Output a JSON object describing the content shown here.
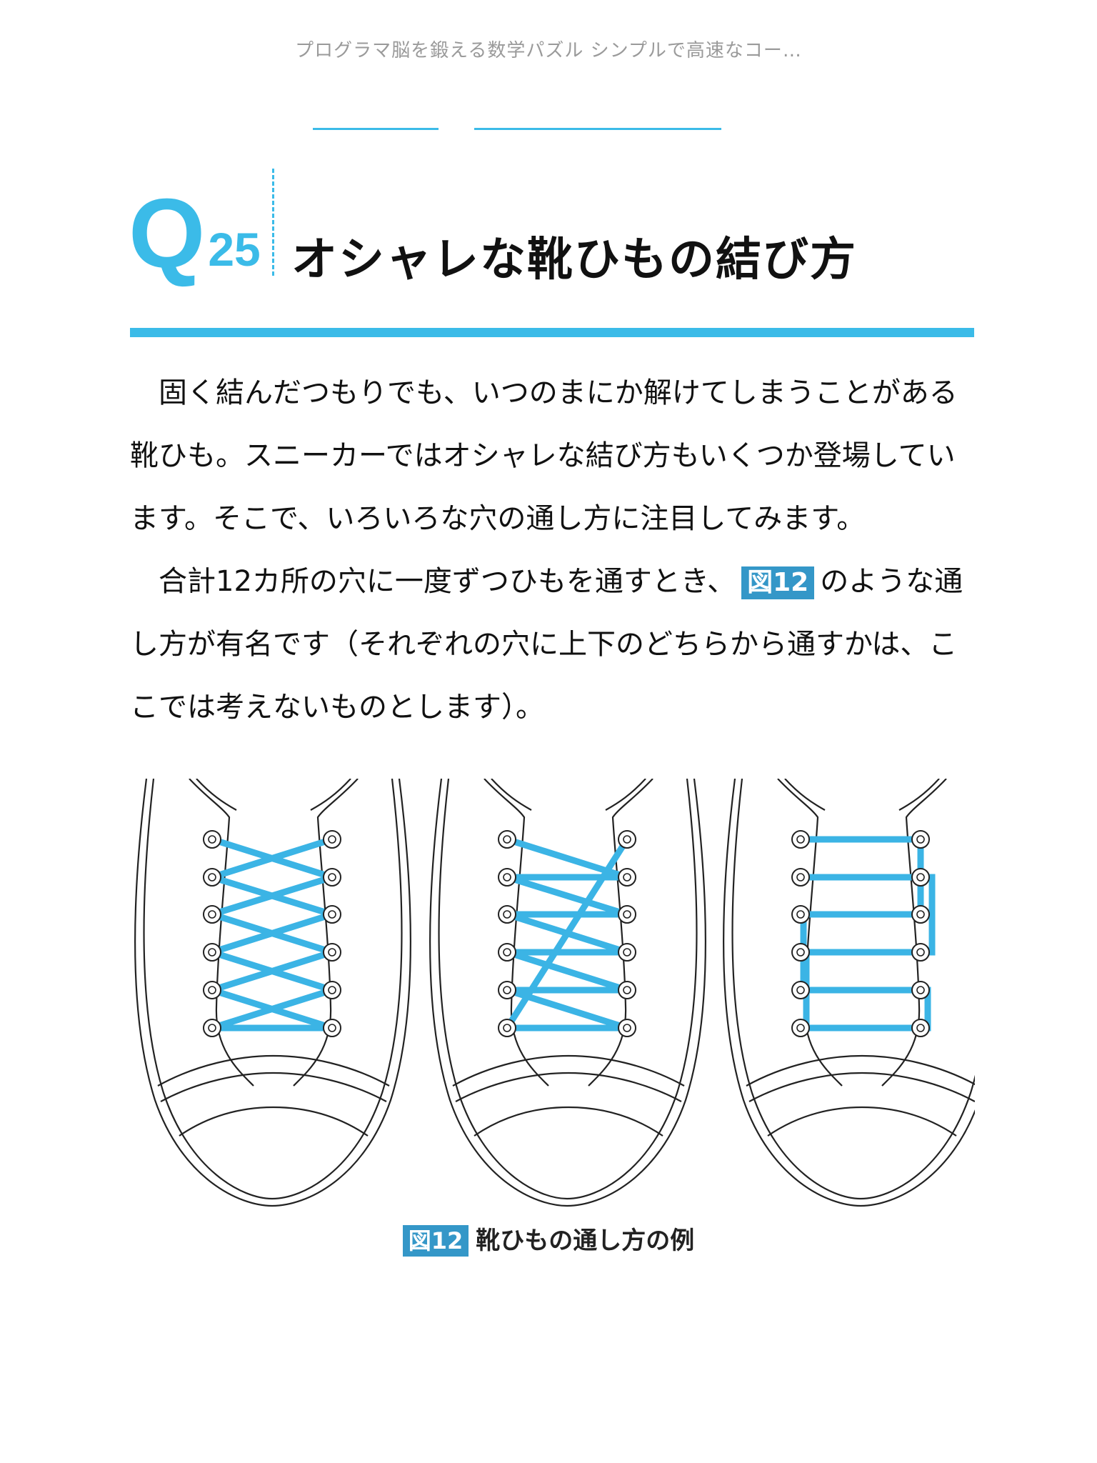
{
  "header": {
    "book_title": "プログラマ脳を鍛える数学パズル シンプルで高速なコー…"
  },
  "question": {
    "q": "Q",
    "number": "25",
    "title": "オシャレな靴ひもの結び方"
  },
  "body": {
    "p1": "固く結んだつもりでも、いつのまにか解けてしまうことがある靴ひも。スニーカーではオシャレな結び方もいくつか登場しています。そこで、いろいろな穴の通し方に注目してみます。",
    "p2_before": "合計12カ所の穴に一度ずつひもを通すとき、",
    "p2_figref": "図12",
    "p2_after": "のような通し方が有名です（それぞれの穴に上下のどちらから通すかは、ここでは考えないものとします）。"
  },
  "figure": {
    "tag": "図12",
    "caption": "靴ひもの通し方の例",
    "lace_color": "#3bb4e5",
    "line_color": "#222222"
  }
}
